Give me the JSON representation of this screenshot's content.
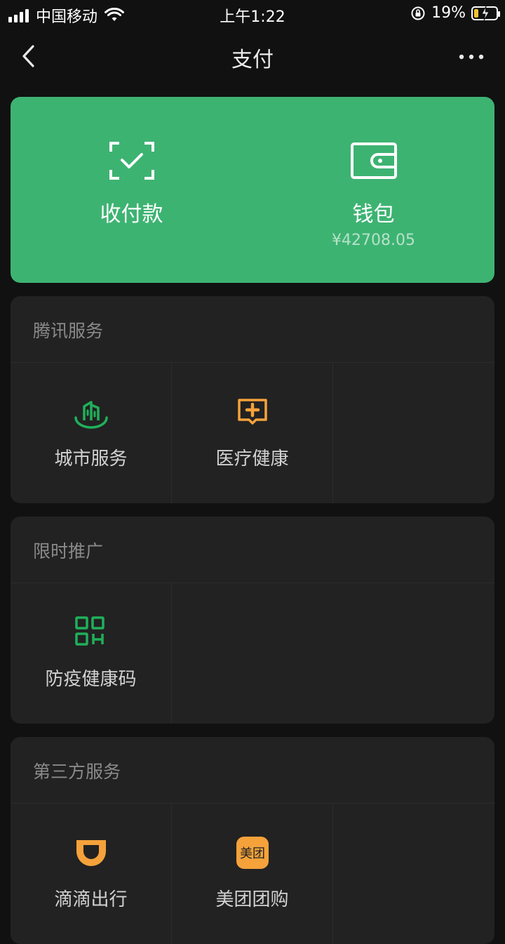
{
  "status_bar": {
    "carrier": "中国移动",
    "time": "上午1:22",
    "battery_percent": "19%",
    "icons": [
      "signal-icon",
      "wifi-icon",
      "orientation-lock-icon",
      "battery-charging-icon"
    ]
  },
  "nav": {
    "title": "支付",
    "back_icon": "chevron-left-icon",
    "more_icon": "more-dots-icon"
  },
  "pay_card": {
    "bg_color": "#3db372",
    "left": {
      "label": "收付款",
      "icon": "scan-check-icon"
    },
    "right": {
      "label": "钱包",
      "balance": "¥42708.05",
      "icon": "wallet-icon"
    }
  },
  "sections": [
    {
      "title": "腾讯服务",
      "items": [
        {
          "label": "城市服务",
          "icon": "city-buildings-icon",
          "color": "#1fb05a"
        },
        {
          "label": "医疗健康",
          "icon": "medical-plus-chat-icon",
          "color": "#f5a23b"
        }
      ]
    },
    {
      "title": "限时推广",
      "items": [
        {
          "label": "防疫健康码",
          "icon": "health-code-icon",
          "color": "#1fb05a"
        }
      ]
    },
    {
      "title": "第三方服务",
      "items": [
        {
          "label": "滴滴出行",
          "icon": "didi-icon",
          "color": "#f5a23b"
        },
        {
          "label": "美团团购",
          "icon": "meituan-icon",
          "badge_text": "美团",
          "color": "#f5a23b"
        }
      ]
    }
  ]
}
